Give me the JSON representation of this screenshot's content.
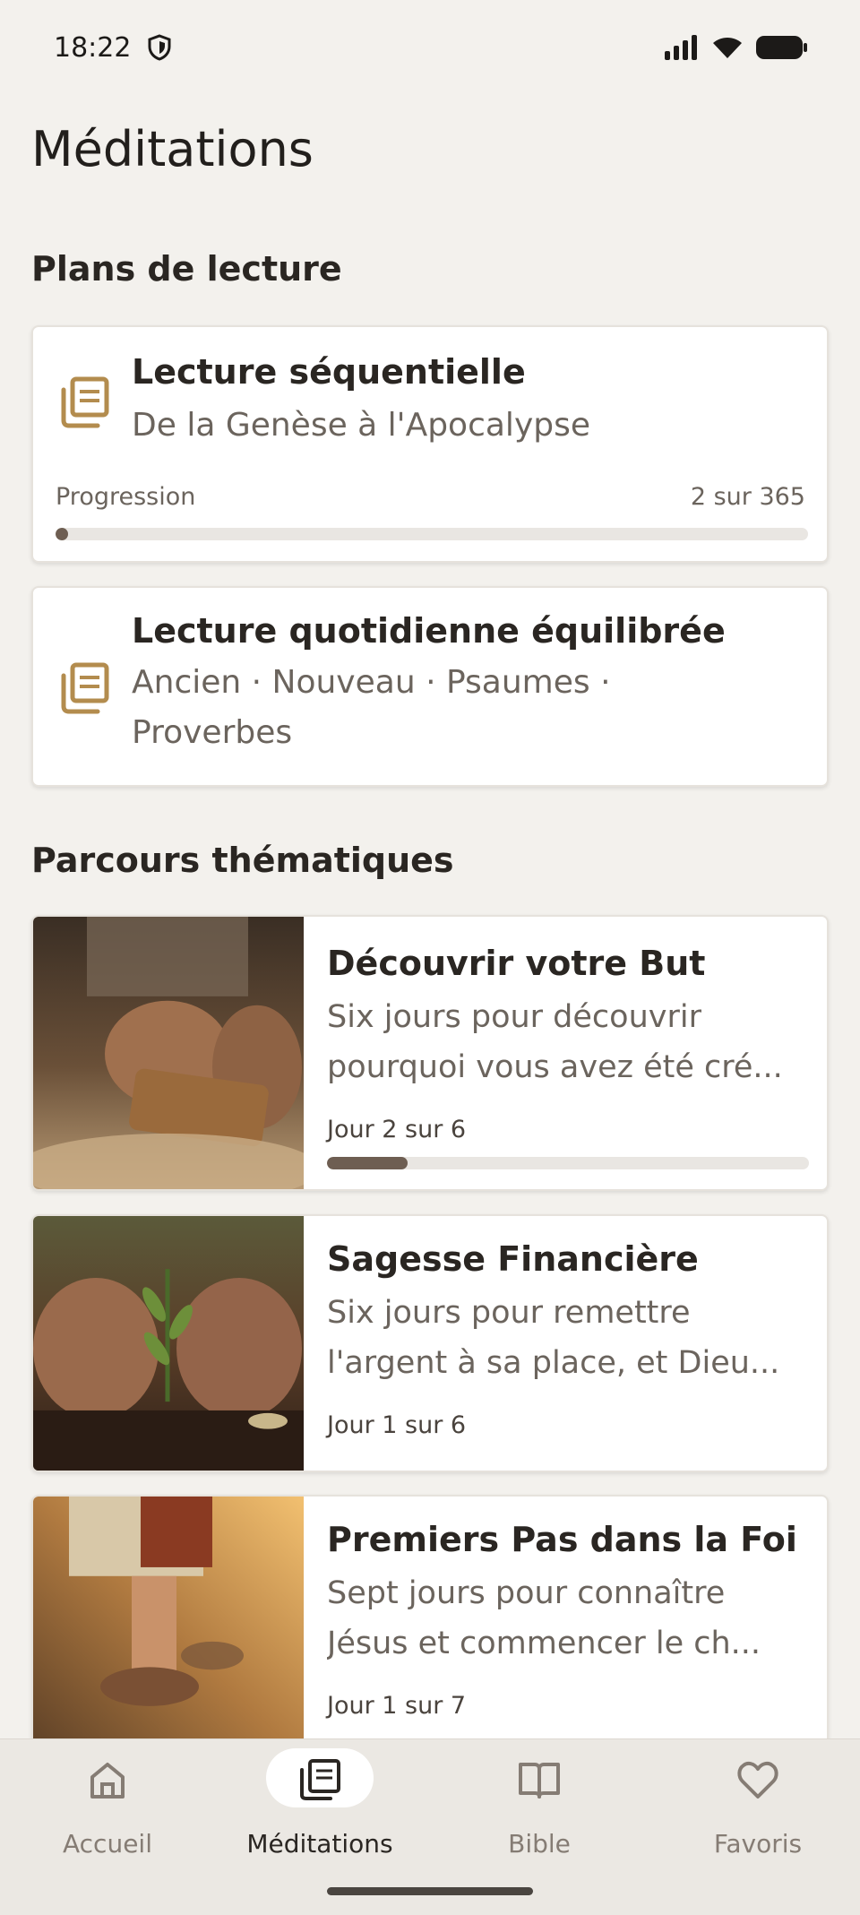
{
  "status_bar": {
    "time": "18:22"
  },
  "page_title": "Méditations",
  "reading_plans": {
    "heading": "Plans de lecture",
    "items": [
      {
        "title": "Lecture séquentielle",
        "subtitle": "De la Genèse à l'Apocalypse",
        "progress_label": "Progression",
        "progress_text": "2 sur 365",
        "progress": 0.005
      },
      {
        "title": "Lecture quotidienne équilibrée",
        "subtitle_line1": "Ancien · Nouveau · Psaumes ·",
        "subtitle_line2": "Proverbes"
      }
    ]
  },
  "thematic": {
    "heading": "Parcours thématiques",
    "items": [
      {
        "title": "Découvrir votre But",
        "desc_line1": "Six jours pour découvrir",
        "desc_line2": "pourquoi vous avez été cré...",
        "day": "Jour 2 sur 6",
        "progress": 0.1667
      },
      {
        "title": "Sagesse Financière",
        "desc_line1": "Six jours pour remettre",
        "desc_line2": "l'argent à sa place, et Dieu...",
        "day": "Jour 1 sur 6"
      },
      {
        "title": "Premiers Pas dans la Foi",
        "desc_line1": "Sept jours pour connaître",
        "desc_line2": "Jésus et commencer le ch...",
        "day": "Jour 1 sur 7"
      }
    ]
  },
  "bottom_nav": {
    "items": [
      {
        "label": "Accueil",
        "icon": "home-icon"
      },
      {
        "label": "Méditations",
        "icon": "book-stack-icon",
        "active": true
      },
      {
        "label": "Bible",
        "icon": "open-book-icon"
      },
      {
        "label": "Favoris",
        "icon": "heart-icon"
      }
    ]
  },
  "colors": {
    "background": "#f3f1ed",
    "accent_icon": "#b38c4e",
    "progress_fill": "#6e5e52",
    "progress_track": "#e9e6e2",
    "text_primary": "#2a2622",
    "text_secondary": "#6b645d"
  }
}
